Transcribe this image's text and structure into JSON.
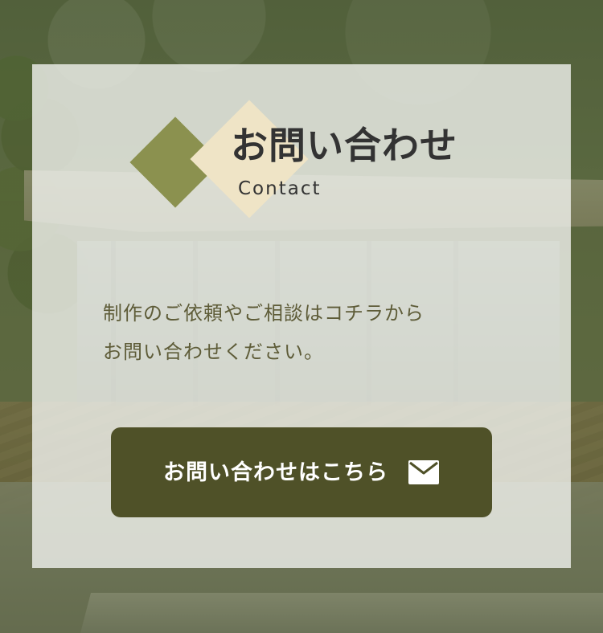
{
  "heading": {
    "title": "お問い合わせ",
    "subtitle": "Contact"
  },
  "description": {
    "line1": "制作のご依頼やご相談はコチラから",
    "line2": "お問い合わせください。"
  },
  "cta": {
    "label": "お問い合わせはこちら",
    "icon": "mail-icon"
  },
  "colors": {
    "accent_green": "#8b914f",
    "accent_cream": "#efe4c6",
    "button": "#4f5128",
    "text_dark": "#333333",
    "text_olive": "#5e5c38"
  }
}
